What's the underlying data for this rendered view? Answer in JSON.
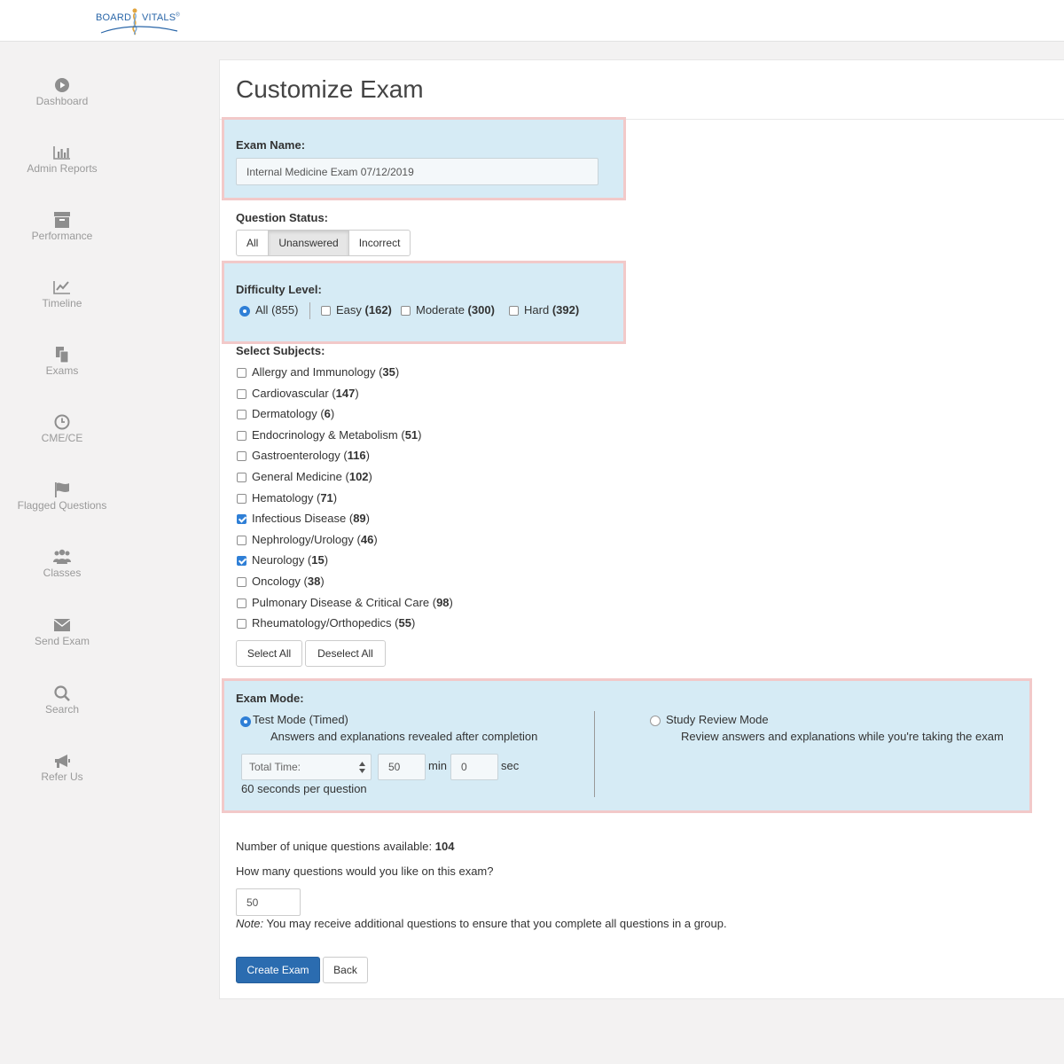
{
  "brand": {
    "left": "BOARD",
    "right": "VITALS",
    "tm": "®"
  },
  "sidebar": {
    "items": [
      {
        "label": "Dashboard",
        "icon": "play-circle-icon"
      },
      {
        "label": "Admin Reports",
        "icon": "bar-chart-icon"
      },
      {
        "label": "Performance",
        "icon": "archive-icon"
      },
      {
        "label": "Timeline",
        "icon": "line-chart-icon"
      },
      {
        "label": "Exams",
        "icon": "copy-files-icon"
      },
      {
        "label": "CME/CE",
        "icon": "clock-icon"
      },
      {
        "label": "Flagged Questions",
        "icon": "flag-icon"
      },
      {
        "label": "Classes",
        "icon": "users-icon"
      },
      {
        "label": "Send Exam",
        "icon": "envelope-icon"
      },
      {
        "label": "Search",
        "icon": "search-icon"
      },
      {
        "label": "Refer Us",
        "icon": "megaphone-icon"
      }
    ]
  },
  "main": {
    "title": "Customize Exam",
    "exam_name": {
      "label": "Exam Name:",
      "value": "Internal Medicine Exam 07/12/2019"
    },
    "question_status": {
      "label": "Question Status:",
      "options": [
        "All",
        "Unanswered",
        "Incorrect"
      ],
      "selected": "Unanswered"
    },
    "difficulty": {
      "label": "Difficulty Level:",
      "options": [
        {
          "name": "All",
          "count": "(855)",
          "type": "radio",
          "checked": true
        },
        {
          "name": "Easy",
          "count": "(162)",
          "type": "checkbox",
          "checked": false
        },
        {
          "name": "Moderate",
          "count": "(300)",
          "type": "checkbox",
          "checked": false
        },
        {
          "name": "Hard",
          "count": "(392)",
          "type": "checkbox",
          "checked": false
        }
      ]
    },
    "subjects": {
      "label": "Select Subjects:",
      "items": [
        {
          "name": "Allergy and Immunology",
          "count": "35",
          "checked": false
        },
        {
          "name": "Cardiovascular",
          "count": "147",
          "checked": false
        },
        {
          "name": "Dermatology",
          "count": "6",
          "checked": false
        },
        {
          "name": "Endocrinology & Metabolism",
          "count": "51",
          "checked": false
        },
        {
          "name": "Gastroenterology",
          "count": "116",
          "checked": false
        },
        {
          "name": "General Medicine",
          "count": "102",
          "checked": false
        },
        {
          "name": "Hematology",
          "count": "71",
          "checked": false
        },
        {
          "name": "Infectious Disease",
          "count": "89",
          "checked": true
        },
        {
          "name": "Nephrology/Urology",
          "count": "46",
          "checked": false
        },
        {
          "name": "Neurology",
          "count": "15",
          "checked": true
        },
        {
          "name": "Oncology",
          "count": "38",
          "checked": false
        },
        {
          "name": "Pulmonary Disease & Critical Care",
          "count": "98",
          "checked": false
        },
        {
          "name": "Rheumatology/Orthopedics",
          "count": "55",
          "checked": false
        }
      ],
      "select_all": "Select All",
      "deselect_all": "Deselect All"
    },
    "exam_mode": {
      "label": "Exam Mode:",
      "test_mode": {
        "title": "Test Mode (Timed)",
        "desc": "Answers and explanations revealed after completion",
        "checked": true
      },
      "study_mode": {
        "title": "Study Review Mode",
        "desc": "Review answers and explanations while you're taking the exam",
        "checked": false
      },
      "time_select": "Total Time:",
      "minutes": "50",
      "min_label": "min",
      "seconds": "0",
      "sec_label": "sec",
      "per_question": "60 seconds per question"
    },
    "unique_label": "Number of unique questions available:",
    "unique_count": "104",
    "how_many_label": "How many questions would you like on this exam?",
    "how_many_value": "50",
    "note_label": "Note:",
    "note_text": "You may receive additional questions to ensure that you complete all questions in a group.",
    "create_button": "Create Exam",
    "back_button": "Back"
  },
  "colors": {
    "highlight": "#d6ebf5",
    "highlight_border": "#f2c9c9",
    "primary": "#2b6cb0",
    "check": "#2f7fd6"
  }
}
